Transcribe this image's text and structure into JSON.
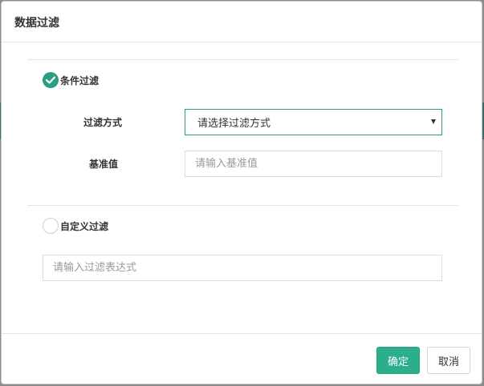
{
  "dialog": {
    "title": "数据过滤"
  },
  "condition_filter": {
    "label": "条件过滤",
    "checked": true,
    "method_label": "过滤方式",
    "method_select_value": "请选择过滤方式",
    "base_value_label": "基准值",
    "base_value_placeholder": "请输入基准值"
  },
  "custom_filter": {
    "label": "自定义过滤",
    "checked": false,
    "expression_placeholder": "请输入过滤表达式"
  },
  "footer": {
    "confirm_label": "确定",
    "cancel_label": "取消"
  },
  "colors": {
    "accent": "#2a9d86",
    "primary_button": "#2aae8c"
  }
}
